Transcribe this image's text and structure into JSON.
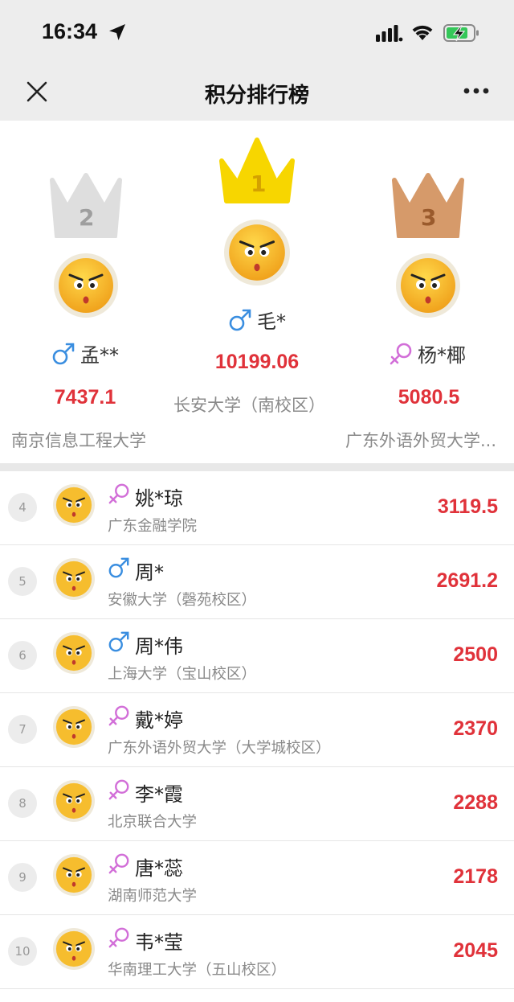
{
  "status_bar": {
    "time": "16:34"
  },
  "nav": {
    "title": "积分排行榜"
  },
  "colors": {
    "score": "#e0323a",
    "male": "#3a8ee0",
    "female": "#d26fd8",
    "gold": "#f7d600",
    "silver": "#dedede",
    "bronze": "#d69a6a"
  },
  "podium": [
    {
      "rank": "2",
      "name": "孟**",
      "gender": "male",
      "score": "7437.1",
      "school": "南京信息工程大学"
    },
    {
      "rank": "1",
      "name": "毛*",
      "gender": "male",
      "score": "10199.06",
      "school": "长安大学（南校区）"
    },
    {
      "rank": "3",
      "name": "杨*椰",
      "gender": "female",
      "score": "5080.5",
      "school": "广东外语外贸大学..."
    }
  ],
  "list": [
    {
      "rank": "4",
      "name": "姚*琼",
      "gender": "female",
      "school": "广东金融学院",
      "score": "3119.5"
    },
    {
      "rank": "5",
      "name": "周*",
      "gender": "male",
      "school": "安徽大学（磬苑校区）",
      "score": "2691.2"
    },
    {
      "rank": "6",
      "name": "周*伟",
      "gender": "male",
      "school": "上海大学（宝山校区）",
      "score": "2500"
    },
    {
      "rank": "7",
      "name": "戴*婷",
      "gender": "female",
      "school": "广东外语外贸大学（大学城校区）",
      "score": "2370"
    },
    {
      "rank": "8",
      "name": "李*霞",
      "gender": "female",
      "school": "北京联合大学",
      "score": "2288"
    },
    {
      "rank": "9",
      "name": "唐*蕊",
      "gender": "female",
      "school": "湖南师范大学",
      "score": "2178"
    },
    {
      "rank": "10",
      "name": "韦*莹",
      "gender": "female",
      "school": "华南理工大学（五山校区）",
      "score": "2045"
    }
  ]
}
